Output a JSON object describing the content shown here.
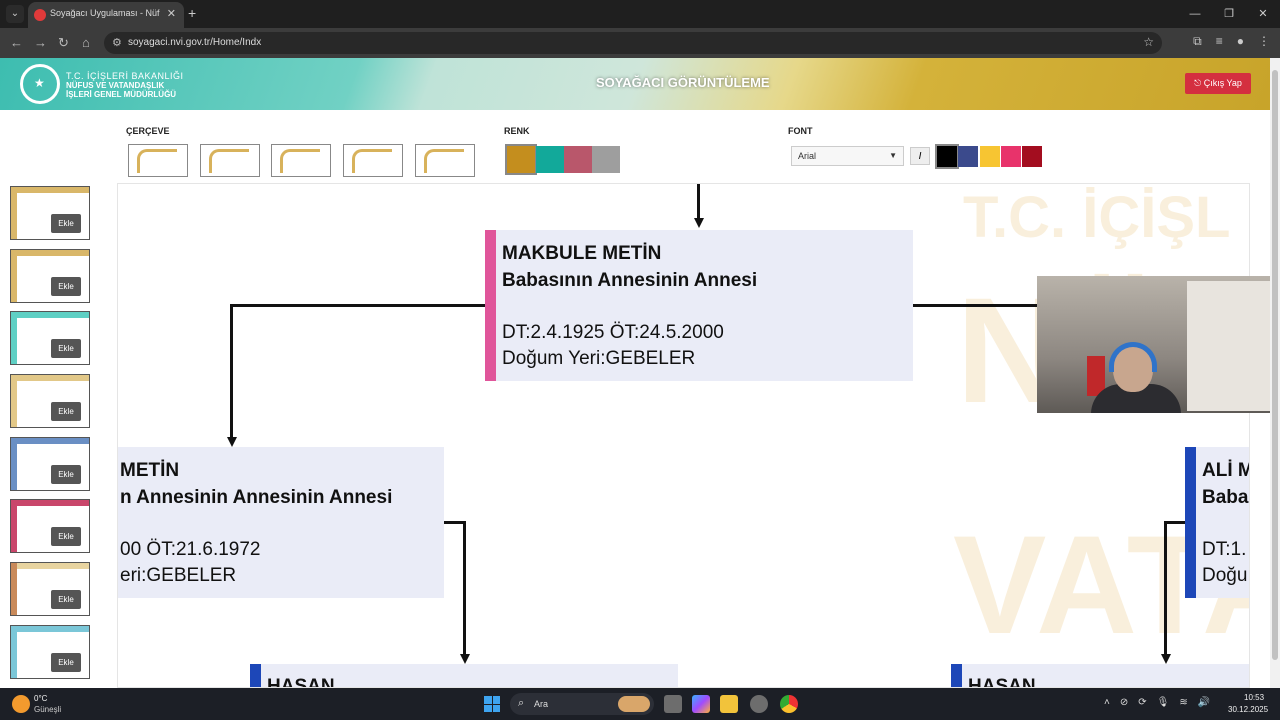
{
  "browser": {
    "tab_title": "Soyağacı Uygulaması - Nüfus ve",
    "url": "soyagaci.nvi.gov.tr/Home/Indx"
  },
  "header": {
    "logo_line1": "T.C. İÇİŞLERİ BAKANLIĞI",
    "logo_line2": "NÜFUS VE VATANDAŞLIK",
    "logo_line3": "İŞLERİ GENEL MÜDÜRLÜĞÜ",
    "title": "SOYAĞACI GÖRÜNTÜLEME",
    "logout_label": "Çıkış Yap"
  },
  "toolbar": {
    "frame_label": "ÇERÇEVE",
    "color_label": "RENK",
    "font_label": "FONT",
    "font_value": "Arial",
    "italic_label": "I",
    "colors": [
      "#c48e1e",
      "#12a99a",
      "#b9576b",
      "#9e9e9e"
    ],
    "font_colors": [
      "#000000",
      "#3b4a8c",
      "#f7c532",
      "#e8336b",
      "#a30d1f"
    ]
  },
  "thumbnails": {
    "add_label": "Ekle",
    "count": 8
  },
  "watermark": {
    "line1": "T.C. İÇİŞL",
    "line2": "NÜ",
    "line3": "VATA"
  },
  "tree": {
    "center": {
      "name": "MAKBULE METİN",
      "relation": "Babasının Annesinin Annesi",
      "dates": "DT:2.4.1925 ÖT:24.5.2000",
      "birthplace": "Doğum Yeri:GEBELER",
      "color": "#e0559a"
    },
    "left": {
      "name": "METİN",
      "relation": "n Annesinin Annesinin Annesi",
      "dates": "00 ÖT:21.6.1972",
      "birthplace": "eri:GEBELER"
    },
    "right": {
      "name": "ALİ M",
      "relation": "Baba",
      "dates": "DT:1.",
      "birthplace": "Doğu",
      "color": "#1d47b8"
    },
    "bottom_left": {
      "name": "HASAN"
    },
    "bottom_right": {
      "name": "HASAN"
    }
  },
  "taskbar": {
    "temp": "0°C",
    "weather": "Güneşli",
    "search_placeholder": "Ara",
    "time": "10:53",
    "date": "30.12.2025"
  }
}
